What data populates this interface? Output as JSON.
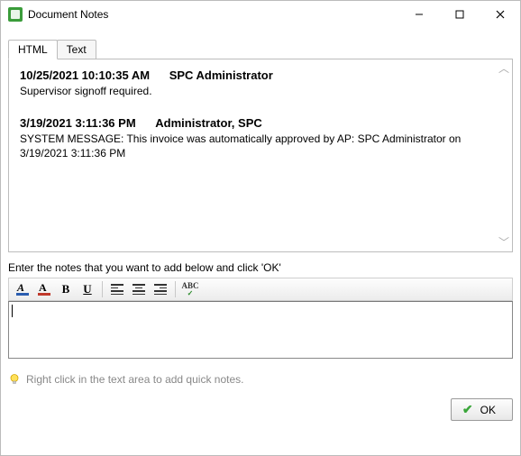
{
  "window": {
    "title": "Document Notes"
  },
  "tabs": {
    "html": "HTML",
    "text": "Text",
    "active": "html"
  },
  "notes": [
    {
      "timestamp": "10/25/2021 10:10:35 AM",
      "author": "SPC Administrator",
      "body": "Supervisor signoff required."
    },
    {
      "timestamp": "3/19/2021 3:11:36 PM",
      "author": "Administrator, SPC",
      "body": "SYSTEM MESSAGE: This invoice was automatically approved by AP: SPC Administrator on 3/19/2021 3:11:36 PM"
    }
  ],
  "instruction": "Enter the notes that you want to add below and click 'OK'",
  "toolbar": {
    "highlight": "Highlight",
    "font_color": "Font Color",
    "bold": "B",
    "underline": "U",
    "align_left": "Align Left",
    "align_center": "Align Center",
    "align_right": "Align Right",
    "spellcheck": "ABC"
  },
  "editor": {
    "value": ""
  },
  "hint": "Right click in the text area to add quick notes.",
  "buttons": {
    "ok": "OK"
  },
  "colors": {
    "highlight_bar": "#2a5db0",
    "fontcolor_bar": "#c0392b"
  }
}
